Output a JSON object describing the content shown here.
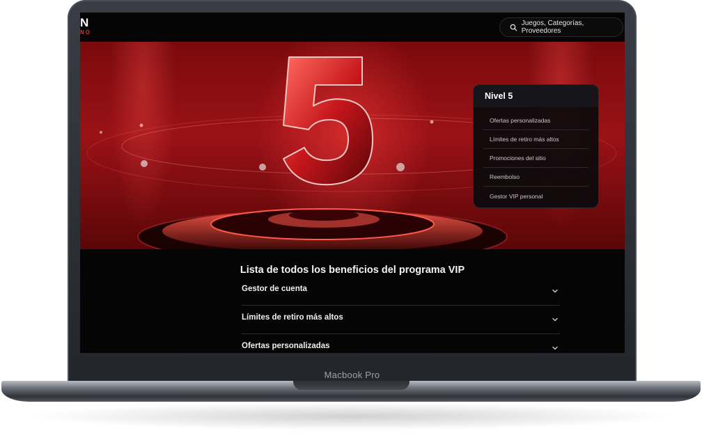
{
  "site": {
    "logo_main": "N",
    "logo_sub": "NO"
  },
  "search": {
    "placeholder": "Juegos, Categorías, Proveedores"
  },
  "hero": {
    "level_number": "5"
  },
  "level_card": {
    "title": "Nivel 5",
    "items": [
      "Ofertas personalizadas",
      "Límites de retiro más altos",
      "Promociones del sitio",
      "Reembolso",
      "Gestor VIP personal"
    ]
  },
  "benefits": {
    "title": "Lista de todos los beneficios del programa VIP",
    "items": [
      "Gestor de cuenta",
      "Límites de retiro más altos",
      "Ofertas personalizadas"
    ]
  },
  "device": {
    "label": "Macbook Pro"
  },
  "colors": {
    "accent_red": "#e8312a",
    "hero_red": "#9a1216",
    "background": "#050505"
  },
  "icons": {
    "search": "search-icon",
    "chevron": "chevron-down-icon"
  }
}
